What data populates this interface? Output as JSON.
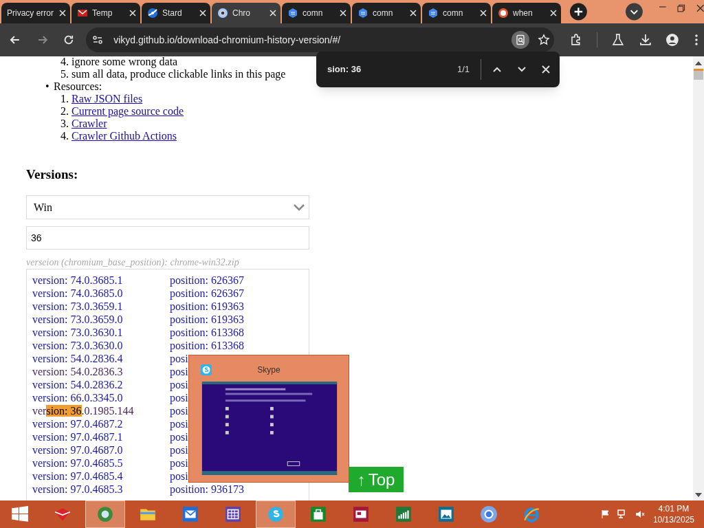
{
  "tabs": [
    {
      "title": "Privacy error",
      "selected": false
    },
    {
      "title": "Temp",
      "selected": false
    },
    {
      "title": "Stard",
      "selected": false
    },
    {
      "title": "Chro",
      "selected": true
    },
    {
      "title": "comn",
      "selected": false
    },
    {
      "title": "comn",
      "selected": false
    },
    {
      "title": "comn",
      "selected": false
    },
    {
      "title": "when",
      "selected": false
    }
  ],
  "address_bar": {
    "url": "vikyd.github.io/download-chromium-history-version/#/"
  },
  "find_bar": {
    "query": "sion: 36",
    "count": "1/1"
  },
  "page": {
    "steps": [
      {
        "number": "4.",
        "text": "ignore some wrong data"
      },
      {
        "number": "5.",
        "text": "sum all data, produce clickable links in this page"
      }
    ],
    "resources": {
      "bullet": "•",
      "label": "Resources:",
      "links": [
        {
          "number": "1.",
          "text": "Raw JSON files"
        },
        {
          "number": "2.",
          "text": "Current page source code"
        },
        {
          "number": "3.",
          "text": "Crawler"
        },
        {
          "number": "4.",
          "text": "Crawler Github Actions"
        }
      ]
    },
    "heading": "Versions:",
    "platform_select": {
      "value": "Win"
    },
    "filter_input": {
      "value": "36"
    },
    "hint": "verseion (chromium_base_position): chrome-win32.zip",
    "rows": [
      {
        "kind": "plain",
        "version": "version: 74.0.3685.1",
        "position": "position: 626367",
        "visited": false
      },
      {
        "kind": "plain",
        "version": "version: 74.0.3685.0",
        "position": "position: 626367",
        "visited": false
      },
      {
        "kind": "plain",
        "version": "version: 73.0.3659.1",
        "position": "position: 619363",
        "visited": false
      },
      {
        "kind": "plain",
        "version": "version: 73.0.3659.0",
        "position": "position: 619363",
        "visited": false
      },
      {
        "kind": "plain",
        "version": "version: 73.0.3630.1",
        "position": "position: 613368",
        "visited": false
      },
      {
        "kind": "plain",
        "version": "version: 73.0.3630.0",
        "position": "position: 613368",
        "visited": false
      },
      {
        "kind": "plain",
        "version": "version: 54.0.2836.4",
        "position": "posi",
        "visited": false
      },
      {
        "kind": "plain",
        "version": "version: 54.0.2836.3",
        "position": "posi",
        "visited": true
      },
      {
        "kind": "plain",
        "version": "version: 54.0.2836.2",
        "position": "posi",
        "visited": false
      },
      {
        "kind": "plain",
        "version": "version: 66.0.3345.0",
        "position": "posi",
        "visited": false
      },
      {
        "kind": "match",
        "version_parts": [
          "ver",
          "sion: 36",
          ".0.1985.144"
        ],
        "position": "posi",
        "visited": true
      },
      {
        "kind": "plain",
        "version": "version: 97.0.4687.2",
        "position": "posi",
        "visited": false
      },
      {
        "kind": "plain",
        "version": "version: 97.0.4687.1",
        "position": "posi",
        "visited": false
      },
      {
        "kind": "plain",
        "version": "version: 97.0.4687.0",
        "position": "posi",
        "visited": false
      },
      {
        "kind": "plain",
        "version": "version: 97.0.4685.5",
        "position": "posi",
        "visited": false
      },
      {
        "kind": "plain",
        "version": "version: 97.0.4685.4",
        "position": "posi",
        "visited": false
      },
      {
        "kind": "plain",
        "version": "version: 97.0.4685.3",
        "position": "position: 936173",
        "visited": false
      }
    ],
    "top_button": {
      "arrow": "↑",
      "label": "Top"
    }
  },
  "skype_preview": {
    "title": "Skype"
  },
  "taskbar": {
    "apps": [
      {
        "selected": false
      },
      {
        "selected": false
      },
      {
        "selected": true
      },
      {
        "selected": false
      },
      {
        "selected": false
      },
      {
        "selected": false
      },
      {
        "selected": true
      },
      {
        "selected": false
      },
      {
        "selected": false
      },
      {
        "selected": false
      },
      {
        "selected": false
      },
      {
        "selected": false
      },
      {
        "selected": false
      }
    ],
    "time": "4:01 PM",
    "date": "10/13/2025"
  }
}
